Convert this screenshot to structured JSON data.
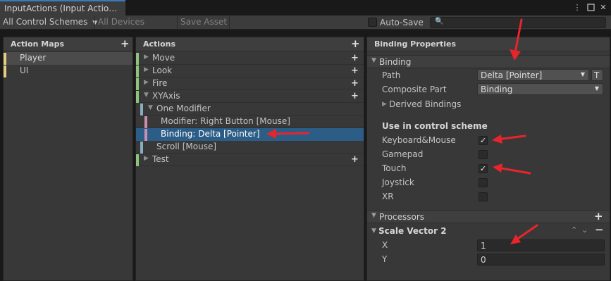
{
  "window": {
    "tab_title": "InputActions (Input Actio…",
    "icons": [
      "more-icon",
      "maximize-icon",
      "close-icon"
    ]
  },
  "toolbar": {
    "control_schemes": "All Control Schemes",
    "devices": "All Devices",
    "save_asset": "Save Asset",
    "auto_save_label": "Auto-Save",
    "auto_save_checked": false,
    "search_value": ""
  },
  "action_maps": {
    "header": "Action Maps",
    "items": [
      {
        "label": "Player",
        "selected": true
      },
      {
        "label": "UI",
        "selected": false
      }
    ]
  },
  "actions": {
    "header": "Actions",
    "items": [
      {
        "label": "Move",
        "kind": "action",
        "expanded": false
      },
      {
        "label": "Look",
        "kind": "action",
        "expanded": false
      },
      {
        "label": "Fire",
        "kind": "action",
        "expanded": false
      },
      {
        "label": "XYAxis",
        "kind": "action",
        "expanded": true
      },
      {
        "label": "One Modifier",
        "kind": "composite",
        "expanded": true
      },
      {
        "label": "Modifier: Right Button [Mouse]",
        "kind": "part",
        "selected": false
      },
      {
        "label": "Binding: Delta [Pointer]",
        "kind": "part",
        "selected": true
      },
      {
        "label": "Scroll [Mouse]",
        "kind": "binding"
      },
      {
        "label": "Test",
        "kind": "action",
        "expanded": false
      }
    ]
  },
  "properties": {
    "header": "Binding Properties",
    "binding_section": "Binding",
    "path_label": "Path",
    "path_value": "Delta [Pointer]",
    "t_button": "T",
    "composite_part_label": "Composite Part",
    "composite_part_value": "Binding",
    "derived_bindings": "Derived Bindings",
    "control_scheme_title": "Use in control scheme",
    "schemes": [
      {
        "label": "Keyboard&Mouse",
        "checked": true
      },
      {
        "label": "Gamepad",
        "checked": false
      },
      {
        "label": "Touch",
        "checked": true
      },
      {
        "label": "Joystick",
        "checked": false
      },
      {
        "label": "XR",
        "checked": false
      }
    ],
    "processors_section": "Processors",
    "scale_vector_title": "Scale Vector 2",
    "x_label": "X",
    "x_value": "1",
    "y_label": "Y",
    "y_value": "0"
  },
  "colors": {
    "selection": "#2c5d87",
    "action_bar": "#8fc27f",
    "composite_bar": "#87aebf",
    "part_bar": "#cc8eb0",
    "map_bar": "#e6ce80",
    "annotation_arrow": "#e8252b"
  }
}
